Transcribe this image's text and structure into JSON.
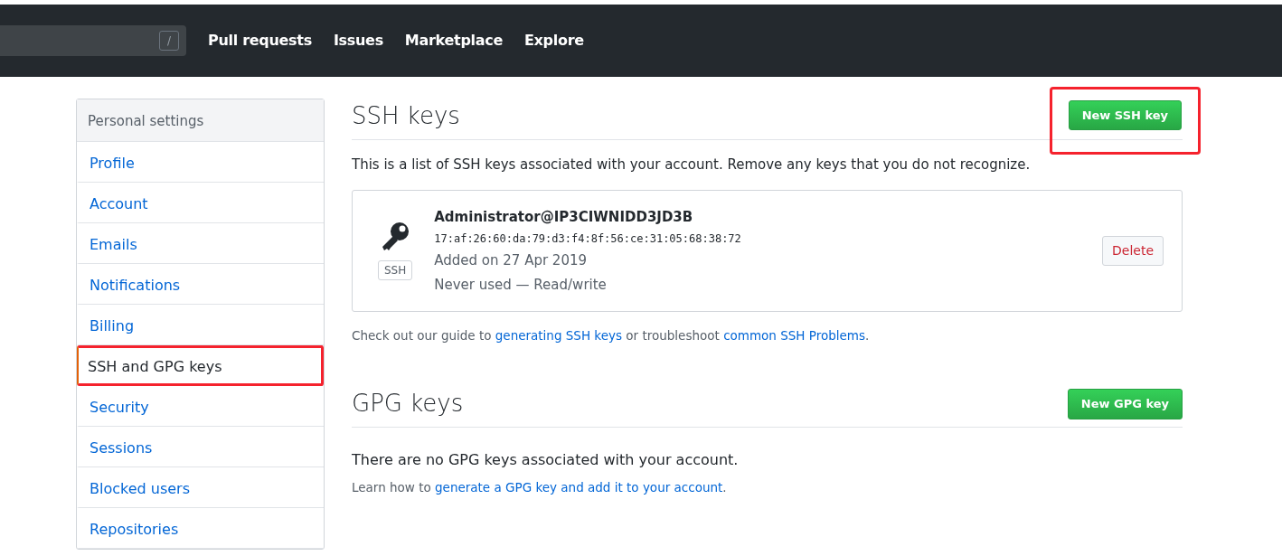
{
  "header": {
    "search_shortcut": "/",
    "nav": [
      "Pull requests",
      "Issues",
      "Marketplace",
      "Explore"
    ]
  },
  "sidebar": {
    "title": "Personal settings",
    "items": [
      {
        "label": "Profile",
        "selected": false,
        "highlighted": false
      },
      {
        "label": "Account",
        "selected": false,
        "highlighted": false
      },
      {
        "label": "Emails",
        "selected": false,
        "highlighted": false
      },
      {
        "label": "Notifications",
        "selected": false,
        "highlighted": false
      },
      {
        "label": "Billing",
        "selected": false,
        "highlighted": false
      },
      {
        "label": "SSH and GPG keys",
        "selected": true,
        "highlighted": true
      },
      {
        "label": "Security",
        "selected": false,
        "highlighted": false
      },
      {
        "label": "Sessions",
        "selected": false,
        "highlighted": false
      },
      {
        "label": "Blocked users",
        "selected": false,
        "highlighted": false
      },
      {
        "label": "Repositories",
        "selected": false,
        "highlighted": false
      }
    ]
  },
  "ssh": {
    "title": "SSH keys",
    "button": {
      "label": "New SSH key",
      "highlighted": true
    },
    "intro": "This is a list of SSH keys associated with your account. Remove any keys that you do not recognize.",
    "keys": [
      {
        "badge": "SSH",
        "name": "Administrator@IP3CIWNIDD3JD3B",
        "fingerprint": "17:af:26:60:da:79:d3:f4:8f:56:ce:31:05:68:38:72",
        "added": "Added on 27 Apr 2019",
        "usage": "Never used — Read/write",
        "action": "Delete"
      }
    ],
    "footer": [
      {
        "kind": "text",
        "text": "Check out our guide to "
      },
      {
        "kind": "link",
        "text": "generating SSH keys"
      },
      {
        "kind": "text",
        "text": " or troubleshoot "
      },
      {
        "kind": "link",
        "text": "common SSH Problems"
      },
      {
        "kind": "text",
        "text": "."
      }
    ]
  },
  "gpg": {
    "title": "GPG keys",
    "button": {
      "label": "New GPG key",
      "highlighted": false
    },
    "empty": "There are no GPG keys associated with your account.",
    "footer": [
      {
        "kind": "text",
        "text": "Learn how to "
      },
      {
        "kind": "link",
        "text": "generate a GPG key and add it to your account"
      },
      {
        "kind": "text",
        "text": "."
      }
    ]
  }
}
